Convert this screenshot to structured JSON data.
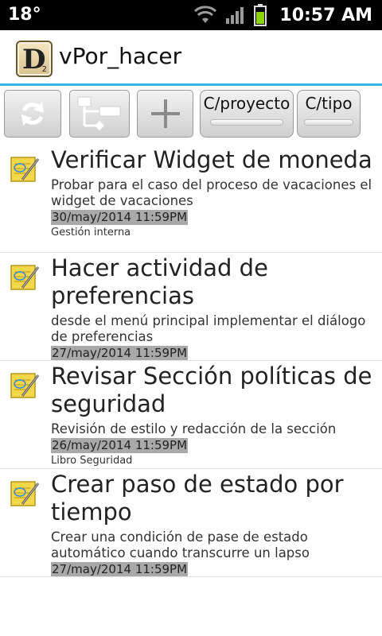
{
  "status_bar": {
    "temperature": "18°",
    "time": "10:57 AM"
  },
  "app": {
    "icon_letter": "D",
    "icon_sub": "2",
    "title": "vPor_hacer"
  },
  "toolbar": {
    "refresh_icon": "refresh-icon",
    "workflow_icon": "workflow-icon",
    "add_icon": "plus-icon",
    "by_project_label": "C/proyecto",
    "by_type_label": "C/tipo"
  },
  "tasks": [
    {
      "title": "Verificar Widget de moneda",
      "description": "Probar para el caso del proceso de vacaciones el widget de vacaciones",
      "date": "30/may/2014 11:59PM",
      "project": "Gestión interna"
    },
    {
      "title": "Hacer actividad de preferencias",
      "description": "desde el menú principal implementar el diálogo de preferencias",
      "date": "27/may/2014 11:59PM",
      "project": ""
    },
    {
      "title": "Revisar Sección políticas de seguridad",
      "description": "Revisión de estilo y redacción de la sección",
      "date": "26/may/2014 11:59PM",
      "project": "Libro Seguridad"
    },
    {
      "title": "Crear paso de estado por tiempo",
      "description": "Crear una condición de pase de estado automático cuando transcurre un lapso",
      "date": "27/may/2014 11:59PM",
      "project": ""
    }
  ],
  "colors": {
    "accent": "#33b5e5",
    "date_highlight": "#a9a9a9"
  }
}
